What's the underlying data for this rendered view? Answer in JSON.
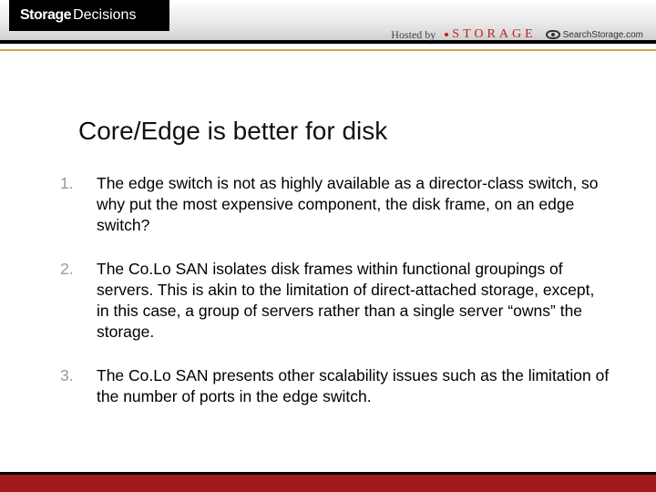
{
  "header": {
    "brand_bold": "Storage",
    "brand_light": "Decisions",
    "hosted_by_label": "Hosted by",
    "sponsor1": "STORAGE",
    "sponsor2": "SearchStorage.com"
  },
  "title": "Core/Edge is better for disk",
  "bullets": [
    "The edge switch is not as highly available as a director-class switch, so why put the most expensive component, the disk frame, on an edge switch?",
    "The Co.Lo SAN isolates disk frames within functional groupings of servers. This is akin to the limitation of direct-attached storage, except, in this case, a group of servers rather than a single server “owns” the storage.",
    "The Co.Lo SAN presents other scalability issues such as the limitation of the number of ports in the edge switch."
  ]
}
